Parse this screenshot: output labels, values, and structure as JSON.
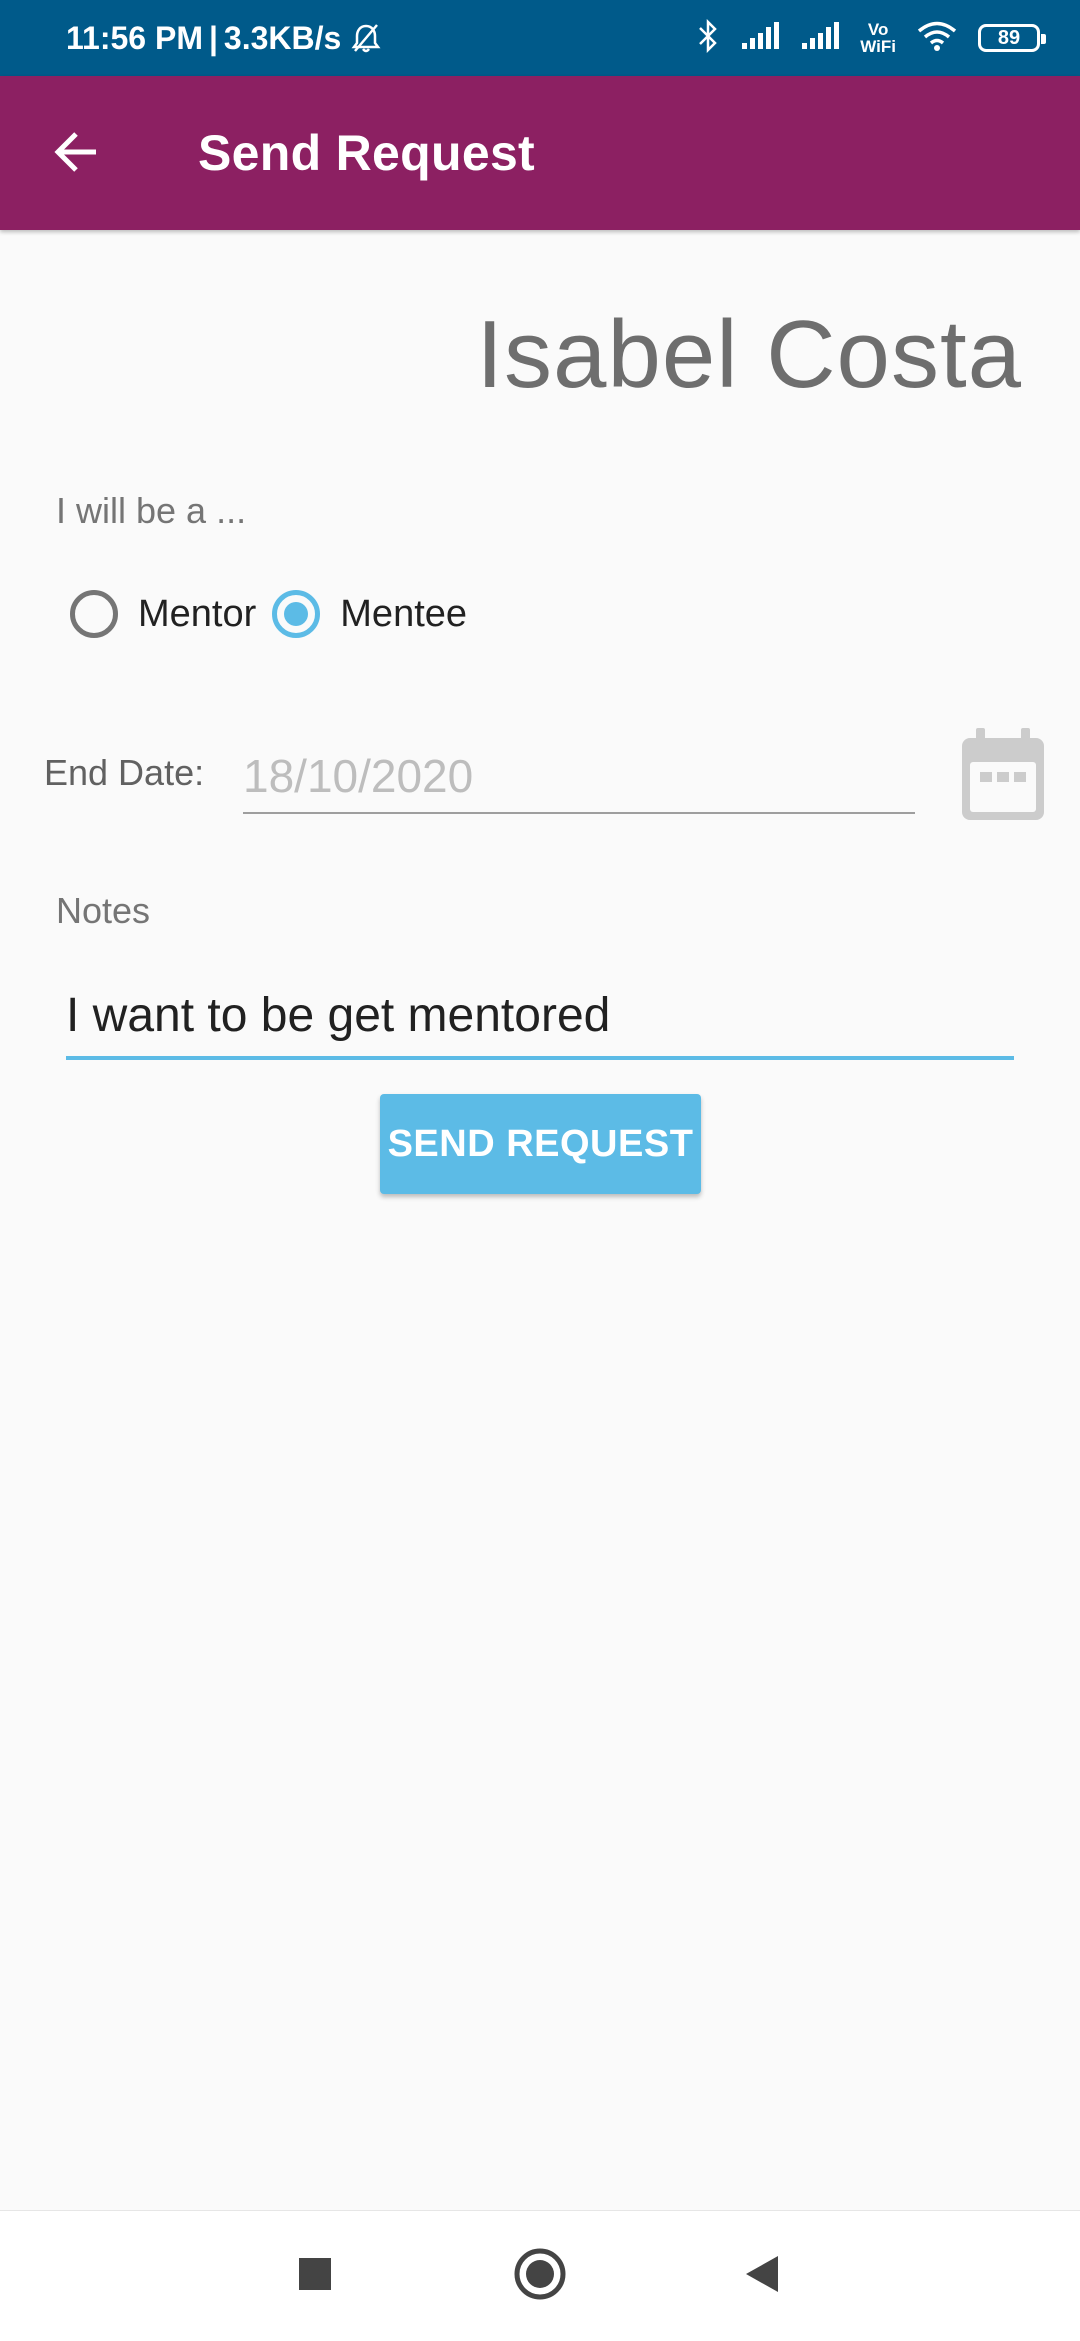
{
  "status_bar": {
    "time": "11:56 PM",
    "separator": "|",
    "net_speed": "3.3KB/s",
    "battery": "89",
    "vowifi_top": "Vo",
    "vowifi_bottom": "WiFi",
    "icons": [
      "mute-notification-icon",
      "bluetooth-icon",
      "signal-icon",
      "signal-icon",
      "vowifi-icon",
      "wifi-icon",
      "battery-icon"
    ]
  },
  "app_bar": {
    "title": "Send Request",
    "back_icon": "arrow-left-icon",
    "background": "#8c2062"
  },
  "form": {
    "person_name": "Isabel Costa",
    "role_label": "I will be a ...",
    "roles": [
      {
        "label": "Mentor",
        "selected": false
      },
      {
        "label": "Mentee",
        "selected": true
      }
    ],
    "end_date_label": "End Date:",
    "end_date_value": "18/10/2020",
    "calendar_icon": "calendar-icon",
    "notes_label": "Notes",
    "notes_value": "I want to be get mentored",
    "submit_label": "SEND REQUEST",
    "accent": "#5cbbe6"
  },
  "nav_bar": {
    "buttons": [
      "recents-square-icon",
      "home-circle-icon",
      "back-triangle-icon"
    ]
  }
}
